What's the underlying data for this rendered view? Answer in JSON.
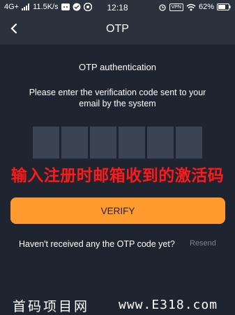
{
  "status_bar": {
    "network": "4G+",
    "speed": "11.5K/s",
    "time": "12:18",
    "vpn": "VPN",
    "battery": "62%"
  },
  "header": {
    "title": "OTP",
    "back_icon": "chevron-left-icon"
  },
  "main": {
    "subtitle": "OTP authentication",
    "instruction": "Please enter the verification code sent to your email by the system",
    "otp_boxes": [
      "",
      "",
      "",
      "",
      "",
      ""
    ],
    "overlay_text": "输入注册时邮箱收到的激活码",
    "verify_label": "VERIFY",
    "resend_prompt": "Haven't received any the OTP code yet?",
    "resend_label": "Resend"
  },
  "watermark": {
    "site_name": "首码项目网",
    "url": "www.E318.com"
  },
  "colors": {
    "background": "#1e2430",
    "header": "#2b313d",
    "otp_box": "#3b4452",
    "accent": "#ff9a2f",
    "overlay_red": "#ff1a1a",
    "muted": "#7c8490"
  }
}
